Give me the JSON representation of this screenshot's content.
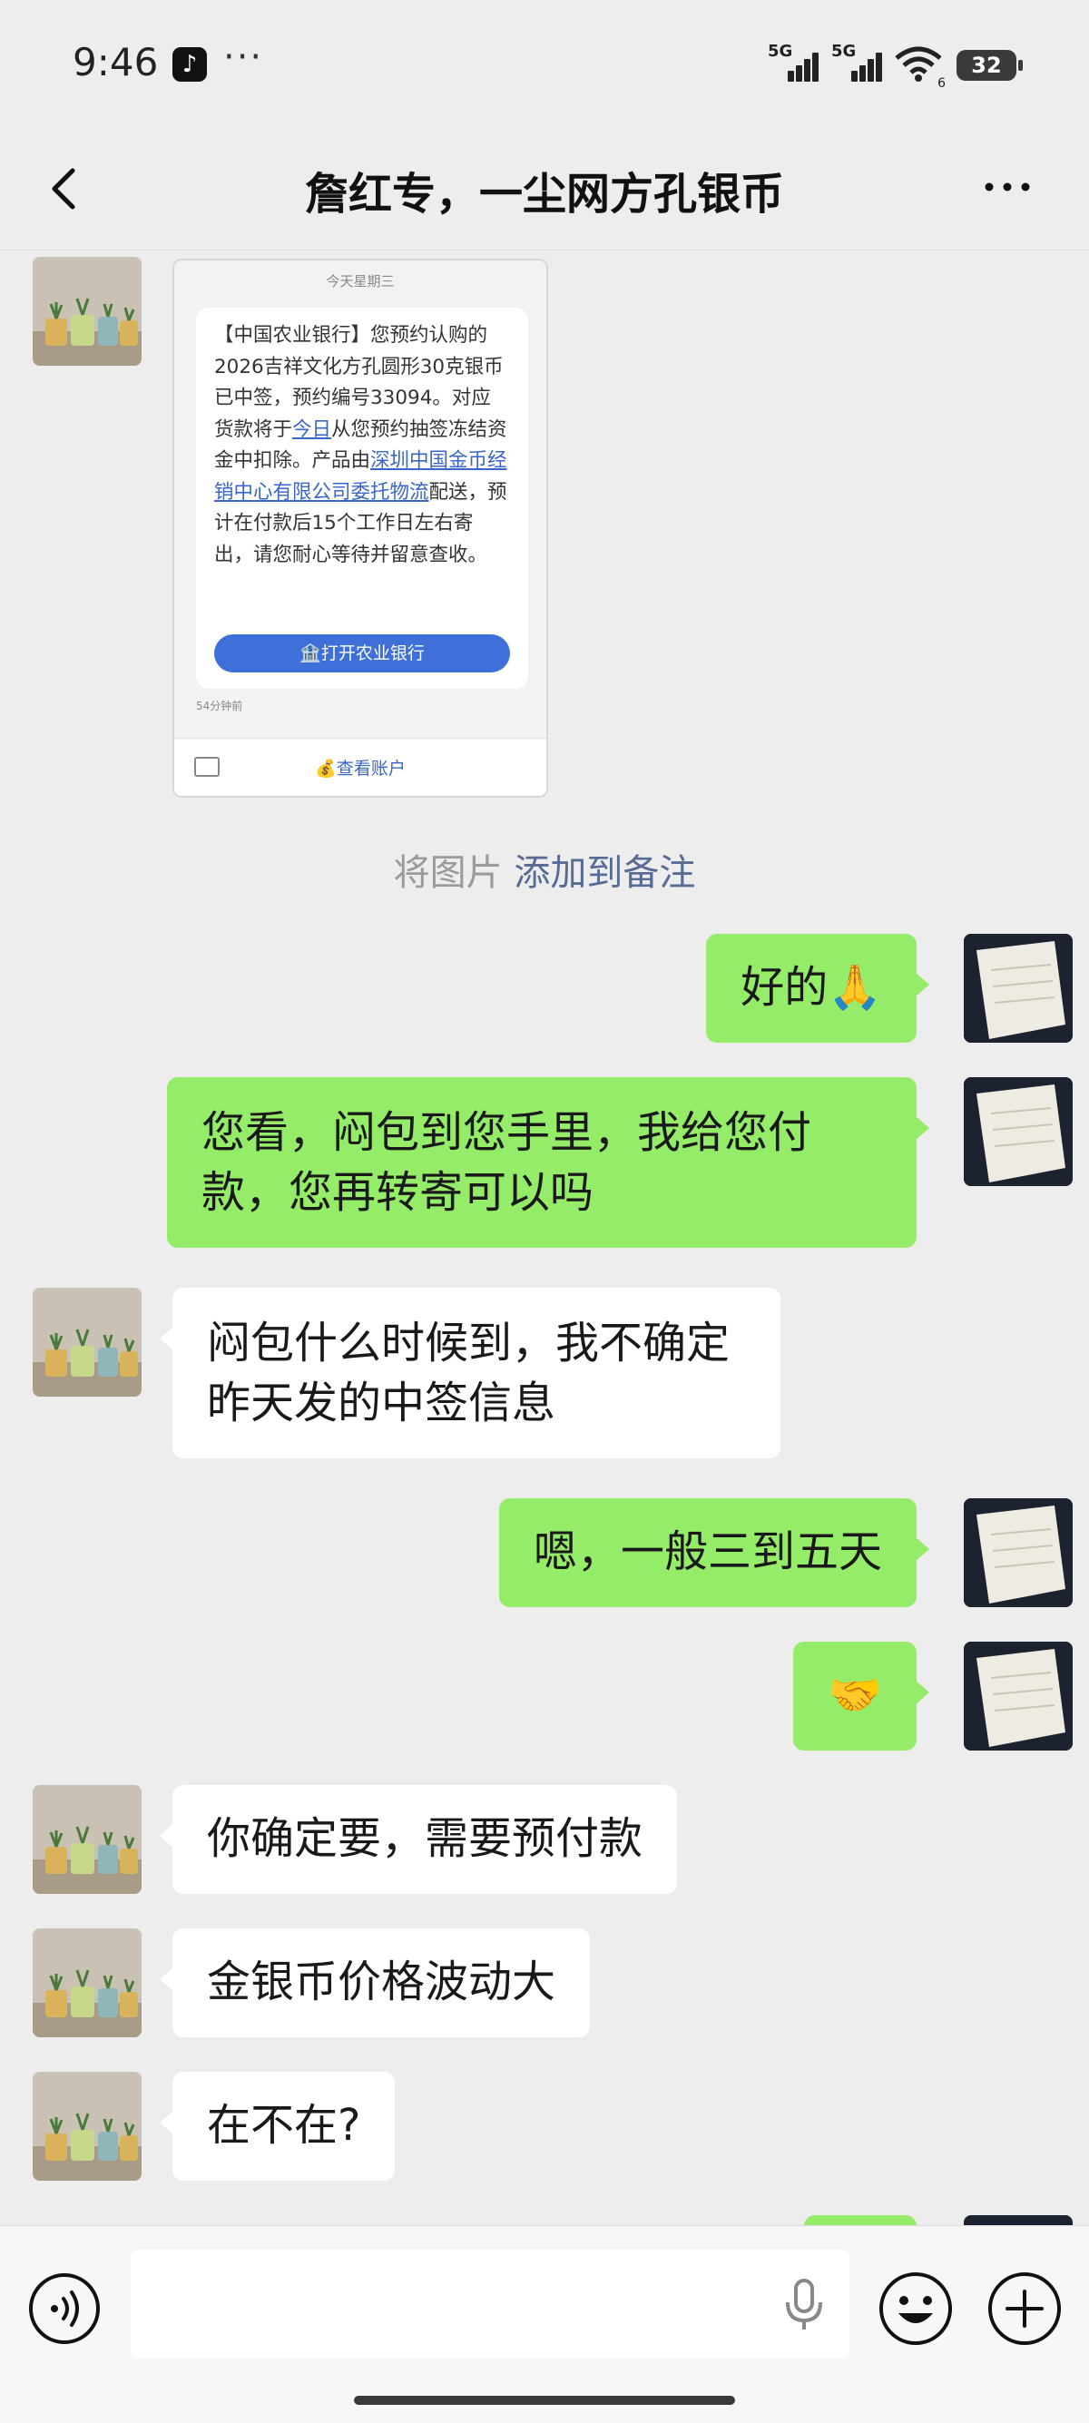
{
  "status_bar": {
    "time": "9:46",
    "app_icon": "tiktok-icon",
    "overflow": "···",
    "signal_1": "5G",
    "signal_2": "5G",
    "wifi_badge": "6",
    "battery": "32"
  },
  "nav": {
    "title": "詹红专，一尘网方孔银币",
    "back_icon": "back-chevron-icon",
    "more_icon": "more-dots-icon"
  },
  "image_message": {
    "date_header": "今天星期三",
    "sms_text_1": "【中国农业银行】您预约认购的2026吉祥文化方孔圆形30克银币已中签，预约编号33094。对应货款将于",
    "sms_link_1": "今日",
    "sms_text_2": "从您预约抽签冻结资金中扣除。产品由",
    "sms_link_2": "深圳中国金币经销中心有限公司委托物流",
    "sms_text_3": "配送，预计在付款后15个工作日左右寄出，请您耐心等待并留意查收。",
    "open_bank_button": "🏦打开农业银行",
    "time_ago": "54分钟前",
    "view_account_button": "💰查看账户"
  },
  "system_note": {
    "prefix": "将图片",
    "link": "添加到备注"
  },
  "messages": [
    {
      "side": "out",
      "text": "好的🙏"
    },
    {
      "side": "out",
      "text": "您看，闷包到您手里，我给您付款，您再转寄可以吗"
    },
    {
      "side": "in",
      "text": "闷包什么时候到，我不确定昨天发的中签信息"
    },
    {
      "side": "out",
      "text": "嗯，一般三到五天"
    },
    {
      "side": "out",
      "text": "🤝"
    },
    {
      "side": "in",
      "text": "你确定要，需要预付款"
    },
    {
      "side": "in",
      "text": "金银币价格波动大"
    },
    {
      "side": "in",
      "text": "在不在?"
    }
  ],
  "input_bar": {
    "voice_icon": "voice-toggle-icon",
    "mic_icon": "microphone-icon",
    "emoji_icon": "emoji-icon",
    "plus_icon": "plus-icon",
    "input_value": ""
  },
  "colors": {
    "background": "#ededed",
    "outgoing_bubble": "#95ec69",
    "incoming_bubble": "#ffffff",
    "link": "#576b95"
  }
}
